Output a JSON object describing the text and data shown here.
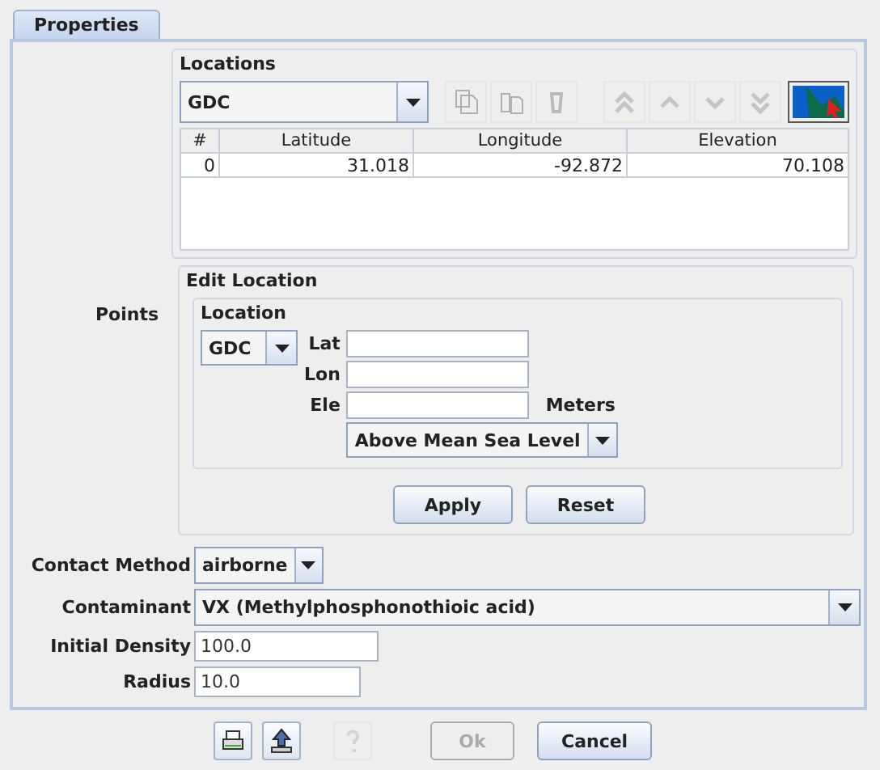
{
  "tabs": [
    {
      "label": "Properties",
      "selected": true
    }
  ],
  "locations": {
    "title": "Locations",
    "system": "GDC",
    "toolbar": [
      {
        "kind": "copy",
        "disabled": true
      },
      {
        "kind": "paste",
        "disabled": true
      },
      {
        "kind": "delete",
        "disabled": true
      },
      {
        "kind": "top",
        "disabled": true
      },
      {
        "kind": "up",
        "disabled": true
      },
      {
        "kind": "down",
        "disabled": true
      },
      {
        "kind": "bottom",
        "disabled": true
      },
      {
        "kind": "map",
        "disabled": false
      }
    ],
    "table": {
      "columns": [
        "#",
        "Latitude",
        "Longitude",
        "Elevation"
      ],
      "rows": [
        [
          "0",
          "31.018",
          "-92.872",
          "70.108"
        ]
      ]
    }
  },
  "points_label": "Points",
  "edit_location": {
    "title": "Edit Location",
    "group": "Location",
    "system": "GDC",
    "fields": [
      {
        "label": "Lat"
      },
      {
        "label": "Lon"
      },
      {
        "label": "Ele",
        "unit": "Meters"
      }
    ],
    "datum": "Above Mean Sea Level",
    "buttons": [
      "Apply",
      "Reset"
    ]
  },
  "form": [
    {
      "kind": "combo",
      "label": "Contact Method",
      "value": "airborne"
    },
    {
      "kind": "wide-combo",
      "label": "Contaminant",
      "value": "VX (Methylphosphonothioic acid)"
    },
    {
      "kind": "text",
      "label": "Initial Density",
      "value": "100.0"
    },
    {
      "kind": "text",
      "label": "Radius",
      "value": "10.0"
    }
  ],
  "footer": {
    "icons": [
      {
        "kind": "print",
        "disabled": false
      },
      {
        "kind": "export",
        "disabled": false
      },
      {
        "kind": "help",
        "disabled": true
      }
    ],
    "buttons": [
      {
        "label": "Ok",
        "disabled": true
      },
      {
        "label": "Cancel",
        "disabled": false
      }
    ]
  }
}
